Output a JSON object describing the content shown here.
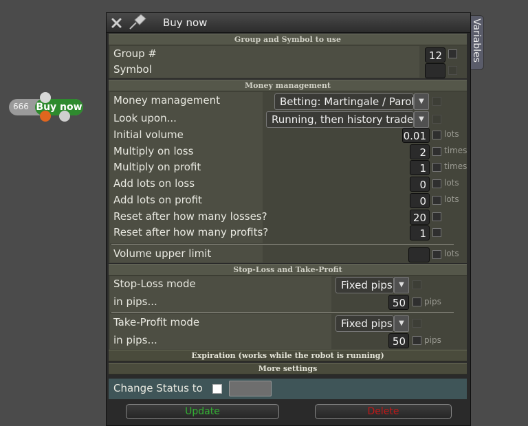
{
  "node": {
    "count": "666",
    "label": "Buy now"
  },
  "window": {
    "title": "Buy now",
    "side_tab": "Variables"
  },
  "sections": {
    "group_symbol": "Group and Symbol to use",
    "money": "Money management",
    "sltp": "Stop-Loss and Take-Profit",
    "expiration": "Expiration (works while the robot is running)",
    "more": "More settings"
  },
  "group": {
    "label": "Group #",
    "value": "12"
  },
  "symbol": {
    "label": "Symbol",
    "value": ""
  },
  "money": {
    "mm_label": "Money management",
    "mm_value": "Betting: Martingale / Paroli",
    "look_label": "Look upon...",
    "look_value": "Running, then history trades",
    "rows": [
      {
        "label": "Initial volume",
        "value": "0.01",
        "unit": "lots"
      },
      {
        "label": "Multiply on loss",
        "value": "2",
        "unit": "times"
      },
      {
        "label": "Multiply on profit",
        "value": "1",
        "unit": "times"
      },
      {
        "label": "Add lots on loss",
        "value": "0",
        "unit": "lots"
      },
      {
        "label": "Add lots on profit",
        "value": "0",
        "unit": "lots"
      },
      {
        "label": "Reset after how many losses?",
        "value": "20",
        "unit": ""
      },
      {
        "label": "Reset after how many profits?",
        "value": "1",
        "unit": ""
      }
    ],
    "upper_label": "Volume upper limit",
    "upper_value": "",
    "upper_unit": "lots"
  },
  "sl": {
    "mode_label": "Stop-Loss mode",
    "mode_value": "Fixed pips",
    "pips_label": "in pips...",
    "pips_value": "50",
    "unit": "pips"
  },
  "tp": {
    "mode_label": "Take-Profit mode",
    "mode_value": "Fixed pips",
    "pips_label": "in pips...",
    "pips_value": "50",
    "unit": "pips"
  },
  "status": {
    "label": "Change Status to",
    "value": ""
  },
  "buttons": {
    "update": "Update",
    "delete": "Delete"
  },
  "colors": {
    "update": "#33b033",
    "delete": "#c01818",
    "node_green": "#2e8a2e"
  }
}
